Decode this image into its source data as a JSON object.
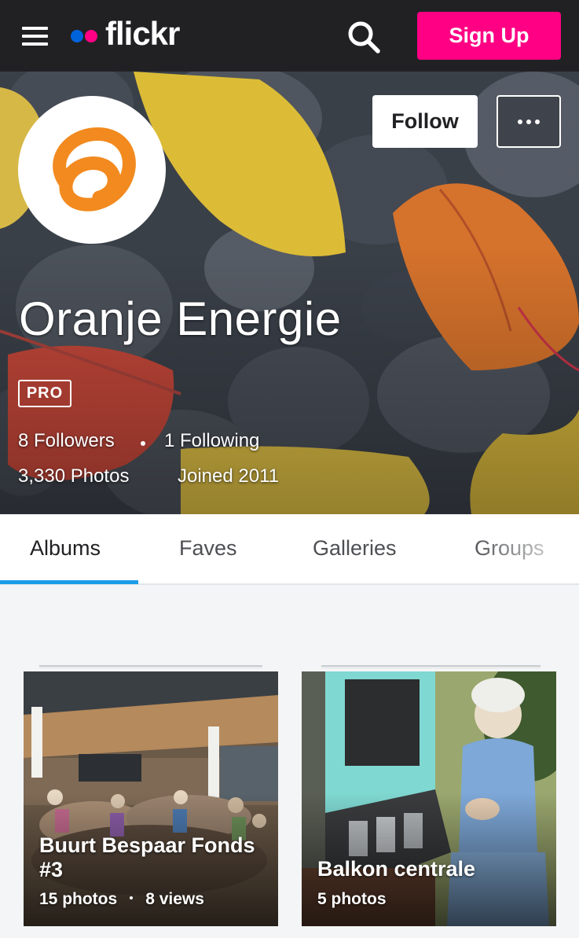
{
  "colors": {
    "nav_bg": "#212124",
    "brand_blue": "#0063dc",
    "brand_pink": "#ff0084",
    "signup_bg": "#ff0084",
    "tab_active_underline": "#1c9be9",
    "avatar_logo": "#f28a1f"
  },
  "topnav": {
    "logo_text": "flickr",
    "signup_label": "Sign Up",
    "menu_icon": "hamburger-icon",
    "search_icon": "search-icon"
  },
  "profile": {
    "name": "Oranje Energie",
    "badge": "PRO",
    "follow_label": "Follow",
    "more_icon": "more-dots-icon",
    "followers": "8 Followers",
    "following": "1 Following",
    "photos": "3,330 Photos",
    "joined": "Joined 2011"
  },
  "tabs": [
    {
      "label": "Albums",
      "active": true
    },
    {
      "label": "Faves",
      "active": false
    },
    {
      "label": "Galleries",
      "active": false
    },
    {
      "label": "Groups",
      "active": false
    }
  ],
  "albums": [
    {
      "title_line1": "Buurt Bespaar Fonds",
      "title_line2": "#3",
      "photos": "15 photos",
      "views": "8 views"
    },
    {
      "title_line1": "Balkon centrale",
      "photos": "5 photos"
    }
  ]
}
